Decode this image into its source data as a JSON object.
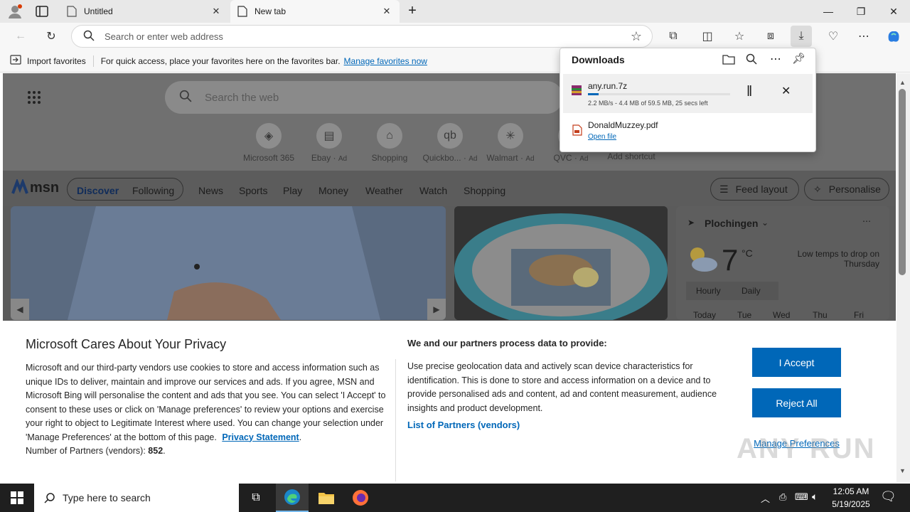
{
  "browser": {
    "tabs": [
      {
        "label": "Untitled"
      },
      {
        "label": "New tab"
      }
    ],
    "address_placeholder": "Search or enter web address",
    "favbar": {
      "import_label": "Import favorites",
      "hint": "For quick access, place your favorites here on the favorites bar.",
      "manage_link": "Manage favorites now"
    }
  },
  "newtab": {
    "search_placeholder": "Search the web",
    "shortcuts": [
      {
        "label": "Microsoft 365"
      },
      {
        "label": "Ebay",
        "ad": "Ad"
      },
      {
        "label": "Shopping"
      },
      {
        "label": "Quickbo...",
        "ad": "Ad"
      },
      {
        "label": "Walmart",
        "ad": "Ad"
      },
      {
        "label": "QVC",
        "ad": "Ad"
      },
      {
        "label": "Add shortcut"
      }
    ],
    "msn": {
      "brand": "msn",
      "tabs": [
        "Discover",
        "Following"
      ],
      "nav": [
        "News",
        "Sports",
        "Play",
        "Money",
        "Weather",
        "Watch",
        "Shopping"
      ],
      "feed_layout": "Feed layout",
      "personalise": "Personalise"
    },
    "weather": {
      "location": "Plochingen",
      "temp": "7",
      "unit": "°C",
      "note": "Low temps to drop on Thursday",
      "tabs": [
        "Hourly",
        "Daily"
      ],
      "days": [
        "Today",
        "Tue",
        "Wed",
        "Thu",
        "Fri"
      ]
    }
  },
  "downloads": {
    "title": "Downloads",
    "items": [
      {
        "name": "any.run.7z",
        "status": "2.2 MB/s - 4.4 MB of 59.5 MB, 25 secs left",
        "progress": 0.074
      },
      {
        "name": "DonaldMuzzey.pdf",
        "action": "Open file"
      }
    ]
  },
  "privacy": {
    "title": "Microsoft Cares About Your Privacy",
    "body": "Microsoft and our third-party vendors use cookies to store and access information such as unique IDs to deliver, maintain and improve our services and ads. If you agree, MSN and Microsoft Bing will personalise the content and ads that you see. You can select 'I Accept' to consent to these uses or click on 'Manage preferences' to review your options and exercise your right to object to Legitimate Interest where used.  You can change your selection under 'Manage Preferences' at the bottom of this page.",
    "privacy_link": "Privacy Statement",
    "partners_label": "Number of Partners (vendors):",
    "partners_count": "852",
    "right_title": "We and our partners process data to provide:",
    "right_body": "Use precise geolocation data and actively scan device characteristics for identification. This is done to store and access information on a device and to provide personalised ads and content, ad and content measurement, audience insights and product development.",
    "partners_link": "List of Partners (vendors)",
    "accept": "I Accept",
    "reject": "Reject All",
    "manage": "Manage Preferences"
  },
  "taskbar": {
    "search_placeholder": "Type here to search",
    "time": "12:05 AM",
    "date": "5/19/2025"
  },
  "watermark": "ANY RUN"
}
